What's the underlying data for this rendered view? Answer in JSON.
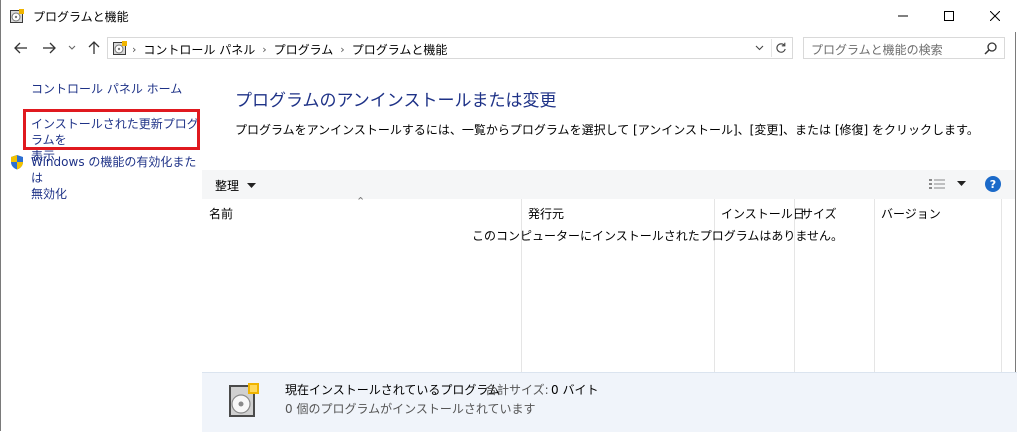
{
  "window": {
    "title": "プログラムと機能"
  },
  "address": {
    "crumbs": [
      "コントロール パネル",
      "プログラム",
      "プログラムと機能"
    ]
  },
  "search": {
    "placeholder": "プログラムと機能の検索"
  },
  "sidebar": {
    "home": "コントロール パネル ホーム",
    "links": [
      {
        "line1": "インストールされた更新プログラムを",
        "line2": "表示"
      },
      {
        "line1": "Windows の機能の有効化または",
        "line2": "無効化"
      }
    ]
  },
  "main": {
    "heading": "プログラムのアンインストールまたは変更",
    "description": "プログラムをアンインストールするには、一覧からプログラムを選択して [アンインストール]、[変更]、または [修復] をクリックします。",
    "organize_label": "整理",
    "columns": [
      "名前",
      "発行元",
      "インストール日",
      "サイズ",
      "バージョン"
    ],
    "empty_message": "このコンピューターにインストールされたプログラムはありません。"
  },
  "details": {
    "title": "現在インストールされているプログラム",
    "total_size_label": "合計サイズ:",
    "total_size_value": "0 バイト",
    "count_text": "0 個のプログラムがインストールされています"
  },
  "colors": {
    "link": "#1e3287",
    "highlight": "#e0191f",
    "details_bg": "#f0f4fa"
  }
}
